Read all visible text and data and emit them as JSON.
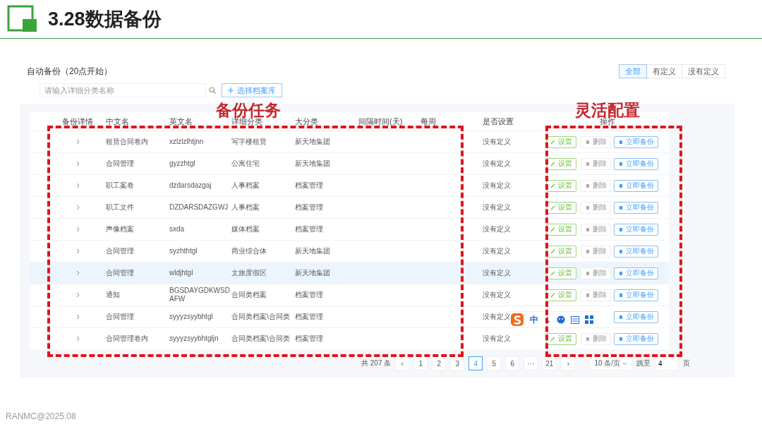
{
  "slide": {
    "title": "3.28数据备份",
    "footer": "RANMC@2025.08"
  },
  "panel": {
    "title": "自动备份（20点开始）",
    "filters": [
      {
        "label": "全部",
        "selected": true
      },
      {
        "label": "有定义",
        "selected": false
      },
      {
        "label": "没有定义",
        "selected": false
      }
    ],
    "search": {
      "placeholder": "请输入详细分类名称"
    },
    "add_button": "选择档案库"
  },
  "table": {
    "columns": [
      "备份详情",
      "中文名",
      "英文名",
      "详细分类",
      "大分类",
      "间隔时间(天)",
      "每周",
      "是否设置",
      "操作"
    ],
    "rows": [
      {
        "selected": false,
        "cells": [
          "",
          "租赁合同卷内",
          "xzlzlzlhtjnn",
          "写字楼租赁",
          "新天地集团",
          "",
          "",
          "没有定义"
        ],
        "actions": [
          {
            "kind": "set",
            "label": "设置",
            "disabled": false
          },
          {
            "kind": "delete",
            "label": "删除",
            "disabled": true
          },
          {
            "kind": "backup",
            "label": "立即备份",
            "disabled": false
          }
        ]
      },
      {
        "selected": false,
        "cells": [
          "",
          "合同管理",
          "gyzzhtgl",
          "公寓住宅",
          "新天地集团",
          "",
          "",
          "没有定义"
        ],
        "actions": [
          {
            "kind": "set",
            "label": "设置",
            "disabled": false
          },
          {
            "kind": "delete",
            "label": "删除",
            "disabled": true
          },
          {
            "kind": "backup",
            "label": "立即备份",
            "disabled": false
          }
        ]
      },
      {
        "selected": false,
        "cells": [
          "",
          "职工案卷",
          "dzdarsdazgaj",
          "人事档案",
          "档案管理",
          "",
          "",
          "没有定义"
        ],
        "actions": [
          {
            "kind": "set",
            "label": "设置",
            "disabled": false
          },
          {
            "kind": "delete",
            "label": "删除",
            "disabled": true
          },
          {
            "kind": "backup",
            "label": "立即备份",
            "disabled": false
          }
        ]
      },
      {
        "selected": false,
        "cells": [
          "",
          "职工文件",
          "DZDARSDAZGWJ",
          "人事档案",
          "档案管理",
          "",
          "",
          "没有定义"
        ],
        "actions": [
          {
            "kind": "set",
            "label": "设置",
            "disabled": false
          },
          {
            "kind": "delete",
            "label": "删除",
            "disabled": true
          },
          {
            "kind": "backup",
            "label": "立即备份",
            "disabled": false
          }
        ]
      },
      {
        "selected": false,
        "cells": [
          "",
          "声像档案",
          "sxda",
          "媒体档案",
          "档案管理",
          "",
          "",
          "没有定义"
        ],
        "actions": [
          {
            "kind": "set",
            "label": "设置",
            "disabled": false
          },
          {
            "kind": "delete",
            "label": "删除",
            "disabled": true
          },
          {
            "kind": "backup",
            "label": "立即备份",
            "disabled": false
          }
        ]
      },
      {
        "selected": false,
        "cells": [
          "",
          "合同管理",
          "syzhthtgl",
          "商业综合体",
          "新天地集团",
          "",
          "",
          "没有定义"
        ],
        "actions": [
          {
            "kind": "set",
            "label": "设置",
            "disabled": false
          },
          {
            "kind": "delete",
            "label": "删除",
            "disabled": true
          },
          {
            "kind": "backup",
            "label": "立即备份",
            "disabled": false
          }
        ]
      },
      {
        "selected": true,
        "cells": [
          "",
          "合同管理",
          "wldjhtgl",
          "文旅度假区",
          "新天地集团",
          "",
          "",
          "没有定义"
        ],
        "actions": [
          {
            "kind": "set",
            "label": "设置",
            "disabled": false
          },
          {
            "kind": "delete",
            "label": "删除",
            "disabled": true
          },
          {
            "kind": "backup",
            "label": "立即备份",
            "disabled": false
          }
        ]
      },
      {
        "selected": false,
        "cells": [
          "",
          "通知",
          "BGSDAYGDKWSDAFW",
          "合同类档案",
          "档案管理",
          "",
          "",
          "没有定义"
        ],
        "actions": [
          {
            "kind": "set",
            "label": "设置",
            "disabled": false
          },
          {
            "kind": "delete",
            "label": "删除",
            "disabled": true
          },
          {
            "kind": "backup",
            "label": "立即备份",
            "disabled": false
          }
        ]
      },
      {
        "selected": false,
        "cells": [
          "",
          "合同管理",
          "syyyzsyybhtgl",
          "合同类档案\\合同类",
          "档案管理",
          "",
          "",
          "没有定义"
        ],
        "actions": [
          {
            "kind": "backup",
            "label": "立即备份",
            "disabled": false
          }
        ]
      },
      {
        "selected": false,
        "cells": [
          "",
          "合同管理卷内",
          "syyyzsyybhtgljn",
          "合同类档案\\合同类",
          "档案管理",
          "",
          "",
          "没有定义"
        ],
        "actions": [
          {
            "kind": "set",
            "label": "设置",
            "disabled": false
          },
          {
            "kind": "delete",
            "label": "删除",
            "disabled": true
          },
          {
            "kind": "backup",
            "label": "立即备份",
            "disabled": false
          }
        ]
      }
    ]
  },
  "pagination": {
    "total": "共 207 条",
    "prev": "‹",
    "next": "›",
    "pages": [
      {
        "label": "1",
        "selected": false
      },
      {
        "label": "2",
        "selected": false
      },
      {
        "label": "3",
        "selected": false
      },
      {
        "label": "4",
        "selected": true
      },
      {
        "label": "5",
        "selected": false
      },
      {
        "label": "6",
        "selected": false
      },
      {
        "label": "···",
        "selected": false
      },
      {
        "label": "21",
        "selected": false
      }
    ],
    "page_size": "10 条/页",
    "jump_label": "跳至",
    "jump_value": "4",
    "jump_suffix": "页"
  },
  "ime_toolbar": {
    "mode": "中"
  },
  "annotations": [
    {
      "kind": "tasks",
      "label": "备份任务"
    },
    {
      "kind": "config",
      "label": "灵活配置"
    }
  ]
}
